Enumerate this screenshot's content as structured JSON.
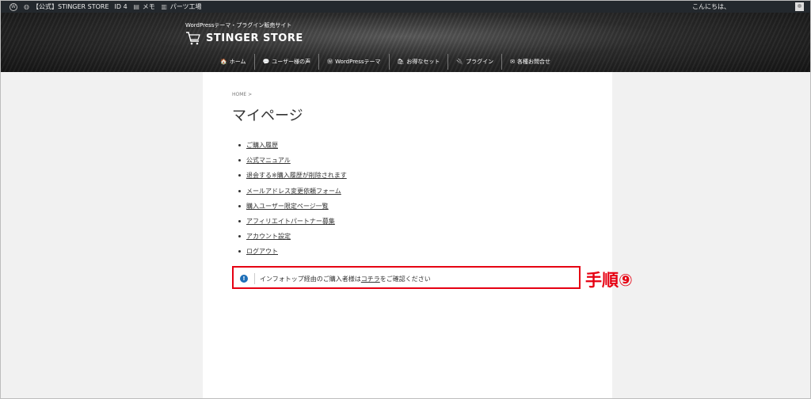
{
  "adminbar": {
    "site": "【公式】STINGER STORE",
    "id": "ID 4",
    "memo": "メモ",
    "parts": "パーツ工場",
    "greeting": "こんにちは、"
  },
  "header": {
    "tagline": "WordPressテーマ・プラグイン販売サイト",
    "brand": "STINGER STORE"
  },
  "nav": [
    {
      "icon": "🏠",
      "label": "ホーム"
    },
    {
      "icon": "💬",
      "label": "ユーザー様の声"
    },
    {
      "icon": "Ⓦ",
      "label": "WordPressテーマ"
    },
    {
      "icon": "🛍",
      "label": "お得なセット"
    },
    {
      "icon": "🔌",
      "label": "プラグイン"
    },
    {
      "icon": "✉",
      "label": "各種お問合せ"
    }
  ],
  "breadcrumb": "HOME >",
  "page_title": "マイページ",
  "links": [
    "ご購入履歴",
    "公式マニュアル",
    "退会する※購入履歴が削除されます",
    "メールアドレス変更依頼フォーム",
    "購入ユーザー限定ページ一覧",
    "アフィリエイトパートナー募集",
    "アカウント設定",
    "ログアウト"
  ],
  "notice": {
    "before": "インフォトップ経由のご購入者様は",
    "link": "コチラ",
    "after": "をご確認ください"
  },
  "annotation": {
    "step_label": "手順⑨",
    "color": "#e60012"
  }
}
